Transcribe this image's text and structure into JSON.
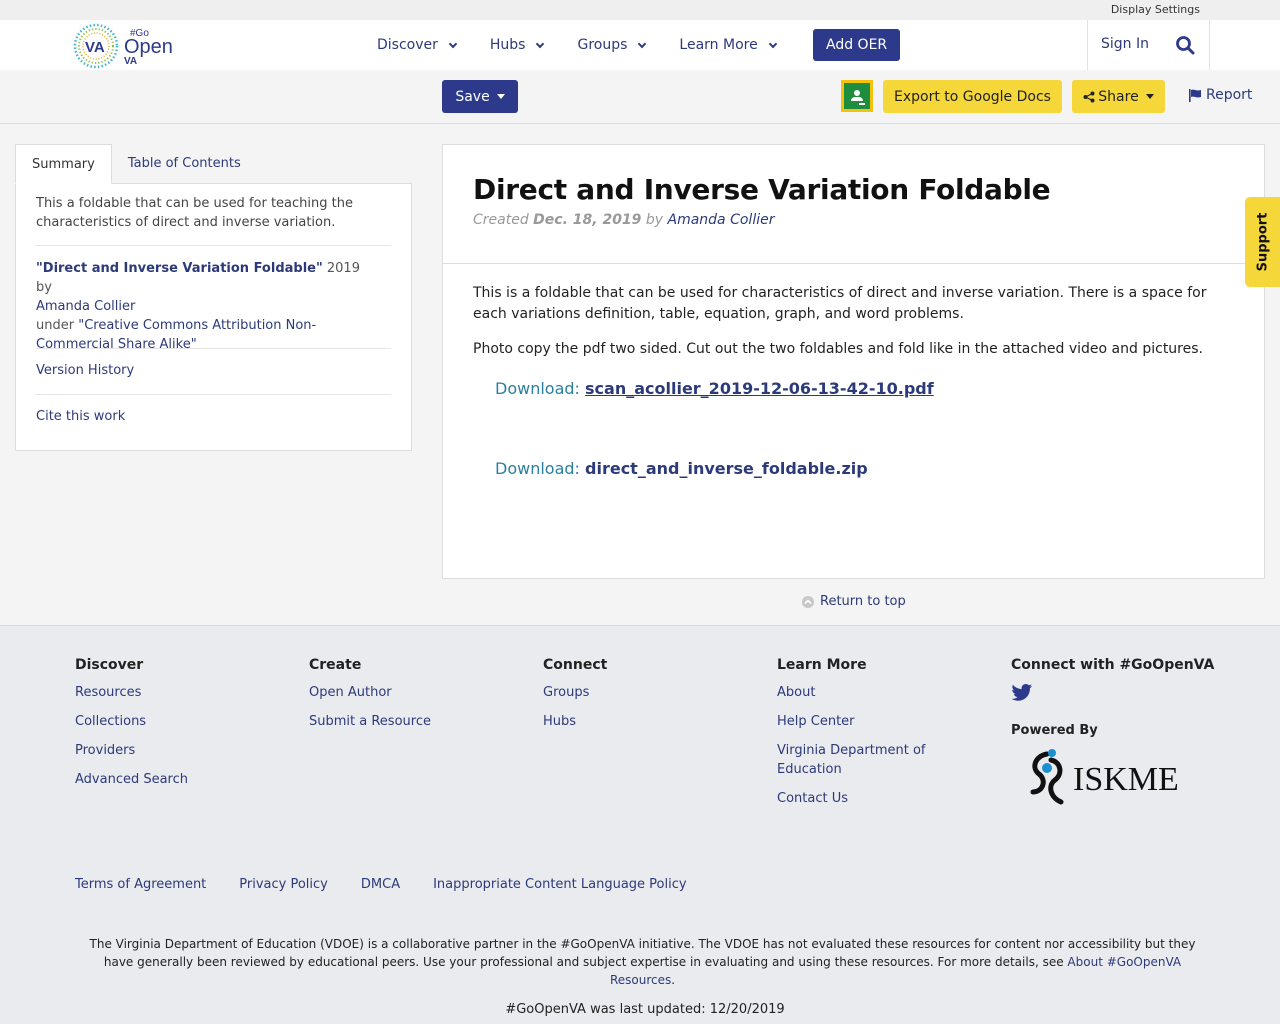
{
  "top_strip": {
    "display_settings": "Display Settings"
  },
  "header": {
    "logo_text": {
      "va": "VA",
      "go": "#Go",
      "open": "Open",
      "va_small": "VA"
    },
    "nav": [
      {
        "label": "Discover"
      },
      {
        "label": "Hubs"
      },
      {
        "label": "Groups"
      },
      {
        "label": "Learn More"
      }
    ],
    "add_oer": "Add OER",
    "sign_in": "Sign In"
  },
  "toolbar": {
    "save": "Save",
    "export": "Export to Google Docs",
    "share": "Share",
    "report": "Report"
  },
  "left": {
    "tabs": [
      "Summary",
      "Table of Contents"
    ],
    "summary": "This a foldable that can be used for teaching the characteristics of direct and inverse variation.",
    "attribution": {
      "title": "\"Direct and Inverse Variation Foldable\"",
      "year_by": " 2019 by",
      "author": "Amanda Collier",
      "under": "under ",
      "license": "\"Creative Commons Attribution Non-Commercial Share Alike\""
    },
    "version_history": "Version History",
    "cite": "Cite this work"
  },
  "main": {
    "title": "Direct and Inverse Variation Foldable",
    "created": "Created",
    "date": "Dec. 18, 2019",
    "by": "by",
    "author": "Amanda Collier",
    "para1": "This is a foldable that can be used for characteristics of direct and inverse variation. There is a space for each variations definition, table, equation, graph, and word problems.",
    "para2": "Photo copy the pdf two sided.  Cut out the two foldables and fold like in the attached video and pictures.",
    "downloads": [
      {
        "label": "Download: ",
        "file": "scan_acollier_2019-12-06-13-42-10.pdf"
      },
      {
        "label": "Download: ",
        "file": "direct_and_inverse_foldable.zip"
      }
    ]
  },
  "return_top": "Return to top",
  "support": "Support",
  "footer": {
    "columns": [
      {
        "heading": "Discover",
        "links": [
          "Resources",
          "Collections",
          "Providers",
          "Advanced Search"
        ]
      },
      {
        "heading": "Create",
        "links": [
          "Open Author",
          "Submit a Resource"
        ]
      },
      {
        "heading": "Connect",
        "links": [
          "Groups",
          "Hubs"
        ]
      },
      {
        "heading": "Learn More",
        "links": [
          "About",
          "Help Center",
          "Virginia Department of Education",
          "Contact Us"
        ]
      }
    ],
    "connect_heading": "Connect with #GoOpenVA",
    "powered_by": "Powered By",
    "iskme": "ISKME",
    "legal": [
      "Terms of Agreement",
      "Privacy Policy",
      "DMCA",
      "Inappropriate Content Language Policy"
    ],
    "disclaimer": "The Virginia Department of Education (VDOE) is a collaborative partner in the #GoOpenVA initiative. The VDOE has not evaluated these resources for content nor accessibility but they have generally been reviewed by educational peers. Use your professional and subject expertise in evaluating and using these resources. For more details, see ",
    "disclaimer_link": "About #GoOpenVA Resources",
    "disclaimer_end": ".",
    "updated": "#GoOpenVA was last updated: 12/20/2019"
  },
  "colors": {
    "brand_blue": "#2d3a8c",
    "link_blue": "#2d3a7a",
    "accent_yellow": "#f5d73a",
    "download_teal": "#2a7fa0"
  }
}
